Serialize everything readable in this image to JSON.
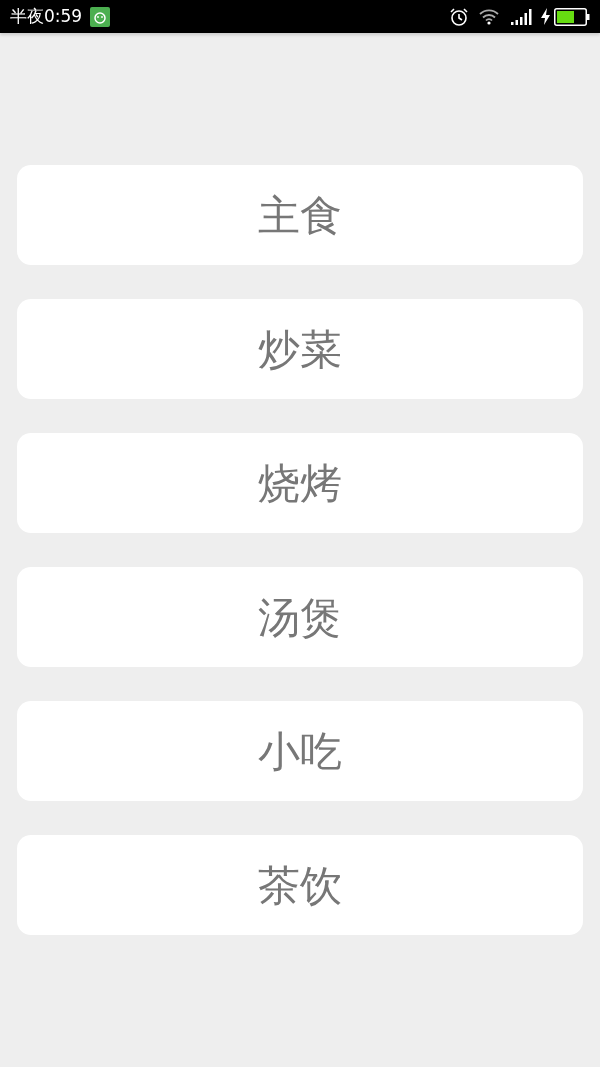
{
  "status_bar": {
    "time": "半夜0:59"
  },
  "menu": [
    {
      "label": "主食"
    },
    {
      "label": "炒菜"
    },
    {
      "label": "烧烤"
    },
    {
      "label": "汤煲"
    },
    {
      "label": "小吃"
    },
    {
      "label": "茶饮"
    }
  ]
}
